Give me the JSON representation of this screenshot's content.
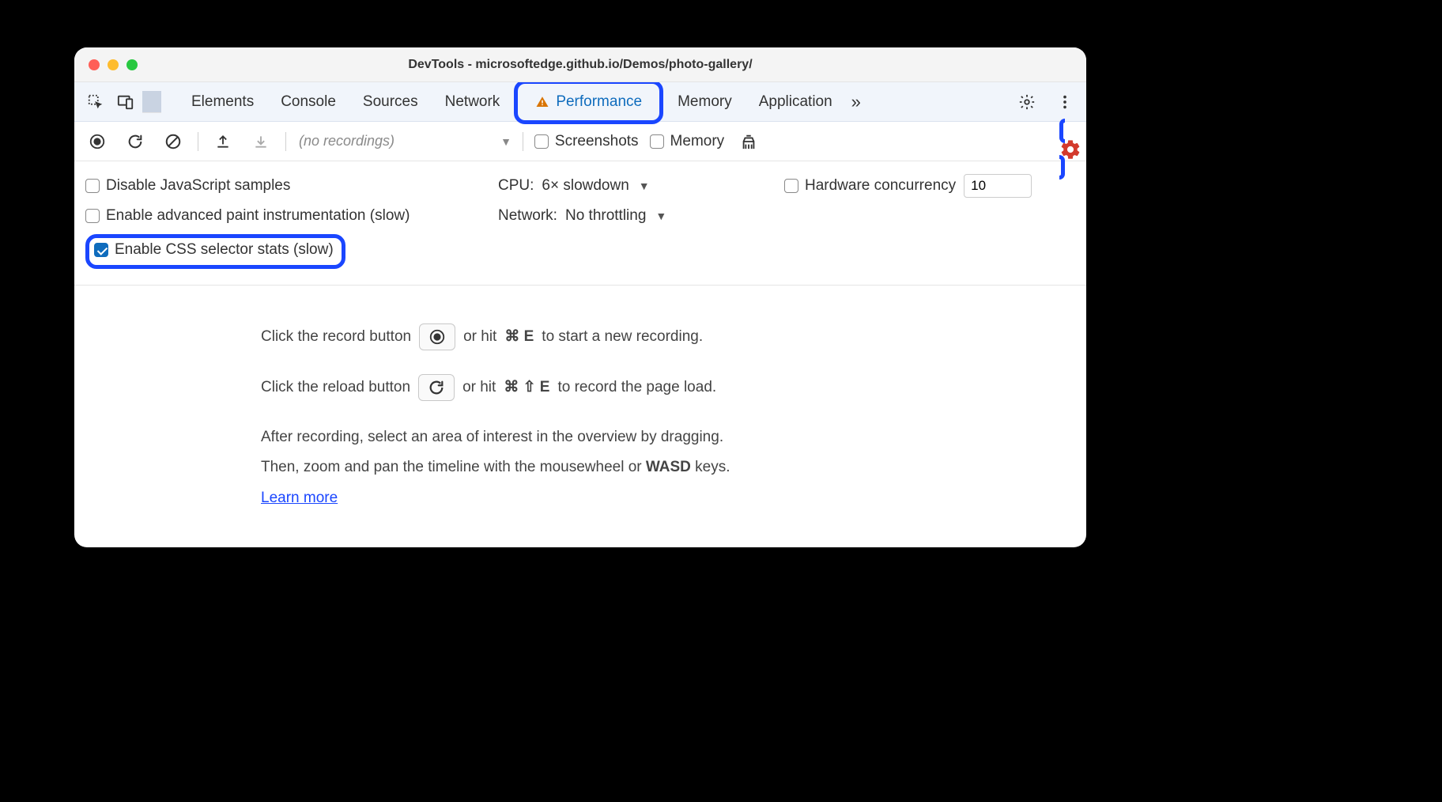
{
  "titlebar": {
    "title": "DevTools - microsoftedge.github.io/Demos/photo-gallery/"
  },
  "tabs": {
    "items": [
      {
        "label": "Elements"
      },
      {
        "label": "Console"
      },
      {
        "label": "Sources"
      },
      {
        "label": "Network"
      },
      {
        "label": "Performance"
      },
      {
        "label": "Memory"
      },
      {
        "label": "Application"
      }
    ]
  },
  "toolbar": {
    "dropdown_placeholder": "(no recordings)",
    "screenshots_label": "Screenshots",
    "memory_label": "Memory"
  },
  "settings": {
    "disable_js": "Disable JavaScript samples",
    "cpu_label": "CPU:",
    "cpu_value": "6× slowdown",
    "hw_concurrency_label": "Hardware concurrency",
    "hw_concurrency_value": "10",
    "paint_instr": "Enable advanced paint instrumentation (slow)",
    "network_label": "Network:",
    "network_value": "No throttling",
    "css_stats": "Enable CSS selector stats (slow)"
  },
  "instructions": {
    "line1_a": "Click the record button",
    "line1_b": "or hit",
    "line1_key": "⌘ E",
    "line1_c": "to start a new recording.",
    "line2_a": "Click the reload button",
    "line2_b": "or hit",
    "line2_key": "⌘ ⇧ E",
    "line2_c": "to record the page load.",
    "para1": "After recording, select an area of interest in the overview by dragging.",
    "para2_a": "Then, zoom and pan the timeline with the mousewheel or ",
    "para2_bold": "WASD",
    "para2_b": " keys.",
    "learn_more": "Learn more"
  }
}
